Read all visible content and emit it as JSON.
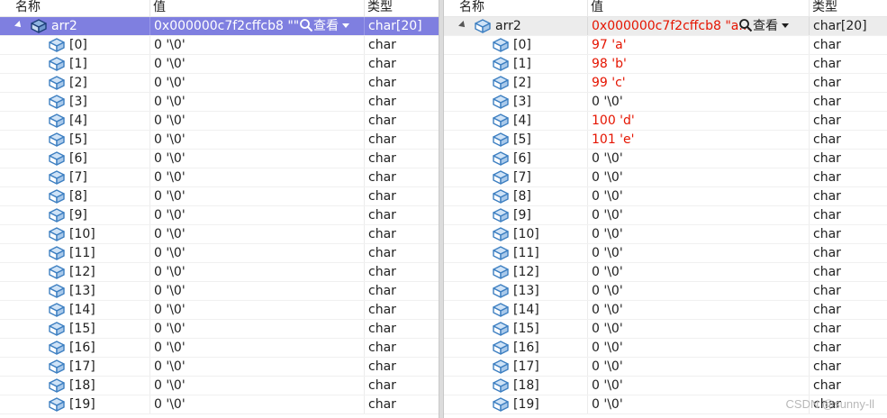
{
  "left": {
    "headers": {
      "name": "名称",
      "value": "值",
      "type": "类型"
    },
    "root": {
      "name": "arr2",
      "value": "0x000000c7f2cffcb8 \"\"",
      "view_label": "查看",
      "type": "char[20]"
    },
    "items": [
      {
        "index": "[0]",
        "value": "0 '\\0'",
        "type": "char"
      },
      {
        "index": "[1]",
        "value": "0 '\\0'",
        "type": "char"
      },
      {
        "index": "[2]",
        "value": "0 '\\0'",
        "type": "char"
      },
      {
        "index": "[3]",
        "value": "0 '\\0'",
        "type": "char"
      },
      {
        "index": "[4]",
        "value": "0 '\\0'",
        "type": "char"
      },
      {
        "index": "[5]",
        "value": "0 '\\0'",
        "type": "char"
      },
      {
        "index": "[6]",
        "value": "0 '\\0'",
        "type": "char"
      },
      {
        "index": "[7]",
        "value": "0 '\\0'",
        "type": "char"
      },
      {
        "index": "[8]",
        "value": "0 '\\0'",
        "type": "char"
      },
      {
        "index": "[9]",
        "value": "0 '\\0'",
        "type": "char"
      },
      {
        "index": "[10]",
        "value": "0 '\\0'",
        "type": "char"
      },
      {
        "index": "[11]",
        "value": "0 '\\0'",
        "type": "char"
      },
      {
        "index": "[12]",
        "value": "0 '\\0'",
        "type": "char"
      },
      {
        "index": "[13]",
        "value": "0 '\\0'",
        "type": "char"
      },
      {
        "index": "[14]",
        "value": "0 '\\0'",
        "type": "char"
      },
      {
        "index": "[15]",
        "value": "0 '\\0'",
        "type": "char"
      },
      {
        "index": "[16]",
        "value": "0 '\\0'",
        "type": "char"
      },
      {
        "index": "[17]",
        "value": "0 '\\0'",
        "type": "char"
      },
      {
        "index": "[18]",
        "value": "0 '\\0'",
        "type": "char"
      },
      {
        "index": "[19]",
        "value": "0 '\\0'",
        "type": "char"
      }
    ]
  },
  "right": {
    "headers": {
      "name": "名称",
      "value": "值",
      "type": "类型"
    },
    "root": {
      "name": "arr2",
      "value": "0x000000c7f2cffcb8 \"a...",
      "view_label": "查看",
      "type": "char[20]"
    },
    "items": [
      {
        "index": "[0]",
        "value": "97 'a'",
        "type": "char",
        "changed": true
      },
      {
        "index": "[1]",
        "value": "98 'b'",
        "type": "char",
        "changed": true
      },
      {
        "index": "[2]",
        "value": "99 'c'",
        "type": "char",
        "changed": true
      },
      {
        "index": "[3]",
        "value": "0 '\\0'",
        "type": "char",
        "changed": false
      },
      {
        "index": "[4]",
        "value": "100 'd'",
        "type": "char",
        "changed": true
      },
      {
        "index": "[5]",
        "value": "101 'e'",
        "type": "char",
        "changed": true
      },
      {
        "index": "[6]",
        "value": "0 '\\0'",
        "type": "char",
        "changed": false
      },
      {
        "index": "[7]",
        "value": "0 '\\0'",
        "type": "char",
        "changed": false
      },
      {
        "index": "[8]",
        "value": "0 '\\0'",
        "type": "char",
        "changed": false
      },
      {
        "index": "[9]",
        "value": "0 '\\0'",
        "type": "char",
        "changed": false
      },
      {
        "index": "[10]",
        "value": "0 '\\0'",
        "type": "char",
        "changed": false
      },
      {
        "index": "[11]",
        "value": "0 '\\0'",
        "type": "char",
        "changed": false
      },
      {
        "index": "[12]",
        "value": "0 '\\0'",
        "type": "char",
        "changed": false
      },
      {
        "index": "[13]",
        "value": "0 '\\0'",
        "type": "char",
        "changed": false
      },
      {
        "index": "[14]",
        "value": "0 '\\0'",
        "type": "char",
        "changed": false
      },
      {
        "index": "[15]",
        "value": "0 '\\0'",
        "type": "char",
        "changed": false
      },
      {
        "index": "[16]",
        "value": "0 '\\0'",
        "type": "char",
        "changed": false
      },
      {
        "index": "[17]",
        "value": "0 '\\0'",
        "type": "char",
        "changed": false
      },
      {
        "index": "[18]",
        "value": "0 '\\0'",
        "type": "char",
        "changed": false
      },
      {
        "index": "[19]",
        "value": "0 '\\0'",
        "type": "char",
        "changed": false
      }
    ]
  },
  "watermark": "CSDN @sunny-ll",
  "colors": {
    "selected_row": "#7f7fe0",
    "changed_value": "#e51400",
    "icon_blue": "#3d7fc1"
  },
  "icons": {
    "variable": "variable-cube-icon",
    "search": "magnifier-icon",
    "expand": "expanded-triangle-icon"
  }
}
